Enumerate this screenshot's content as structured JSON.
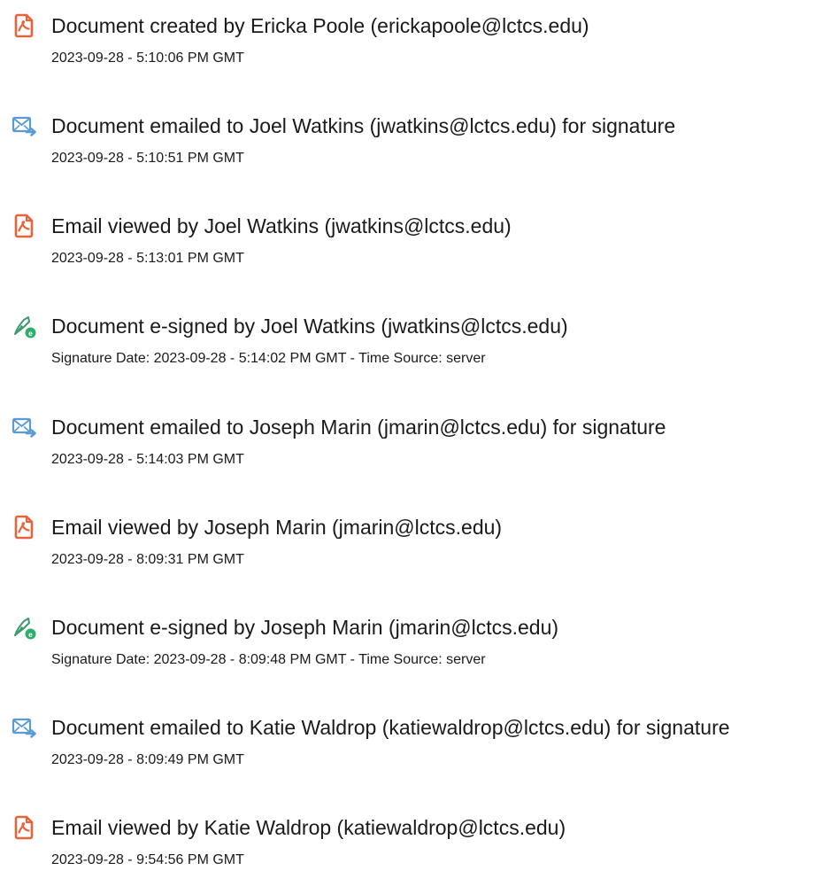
{
  "events": [
    {
      "icon": "document-created-icon",
      "title": "Document created by Ericka Poole (erickapoole@lctcs.edu)",
      "detail": "2023-09-28 - 5:10:06 PM GMT"
    },
    {
      "icon": "email-sent-icon",
      "title": "Document emailed to Joel Watkins (jwatkins@lctcs.edu) for signature",
      "detail": "2023-09-28 - 5:10:51 PM GMT"
    },
    {
      "icon": "email-viewed-icon",
      "title": "Email viewed by Joel Watkins (jwatkins@lctcs.edu)",
      "detail": "2023-09-28 - 5:13:01 PM GMT"
    },
    {
      "icon": "e-signature-icon",
      "title": "Document e-signed by Joel Watkins (jwatkins@lctcs.edu)",
      "detail": "Signature Date: 2023-09-28 - 5:14:02 PM GMT - Time Source: server"
    },
    {
      "icon": "email-sent-icon",
      "title": "Document emailed to Joseph Marin (jmarin@lctcs.edu) for signature",
      "detail": "2023-09-28 - 5:14:03 PM GMT"
    },
    {
      "icon": "email-viewed-icon",
      "title": "Email viewed by Joseph Marin (jmarin@lctcs.edu)",
      "detail": "2023-09-28 - 8:09:31 PM GMT"
    },
    {
      "icon": "e-signature-icon",
      "title": "Document e-signed by Joseph Marin (jmarin@lctcs.edu)",
      "detail": "Signature Date: 2023-09-28 - 8:09:48 PM GMT - Time Source: server"
    },
    {
      "icon": "email-sent-icon",
      "title": "Document emailed to Katie Waldrop (katiewaldrop@lctcs.edu) for signature",
      "detail": "2023-09-28 - 8:09:49 PM GMT"
    },
    {
      "icon": "email-viewed-icon",
      "title": "Email viewed by Katie Waldrop (katiewaldrop@lctcs.edu)",
      "detail": "2023-09-28 - 9:54:56 PM GMT"
    }
  ],
  "colors": {
    "pdf_icon": "#e8633a",
    "email_icon": "#5b9bd5",
    "sign_icon_stroke": "#3d9a6e",
    "sign_icon_badge": "#2eae6b",
    "text": "#1a1a1a"
  }
}
